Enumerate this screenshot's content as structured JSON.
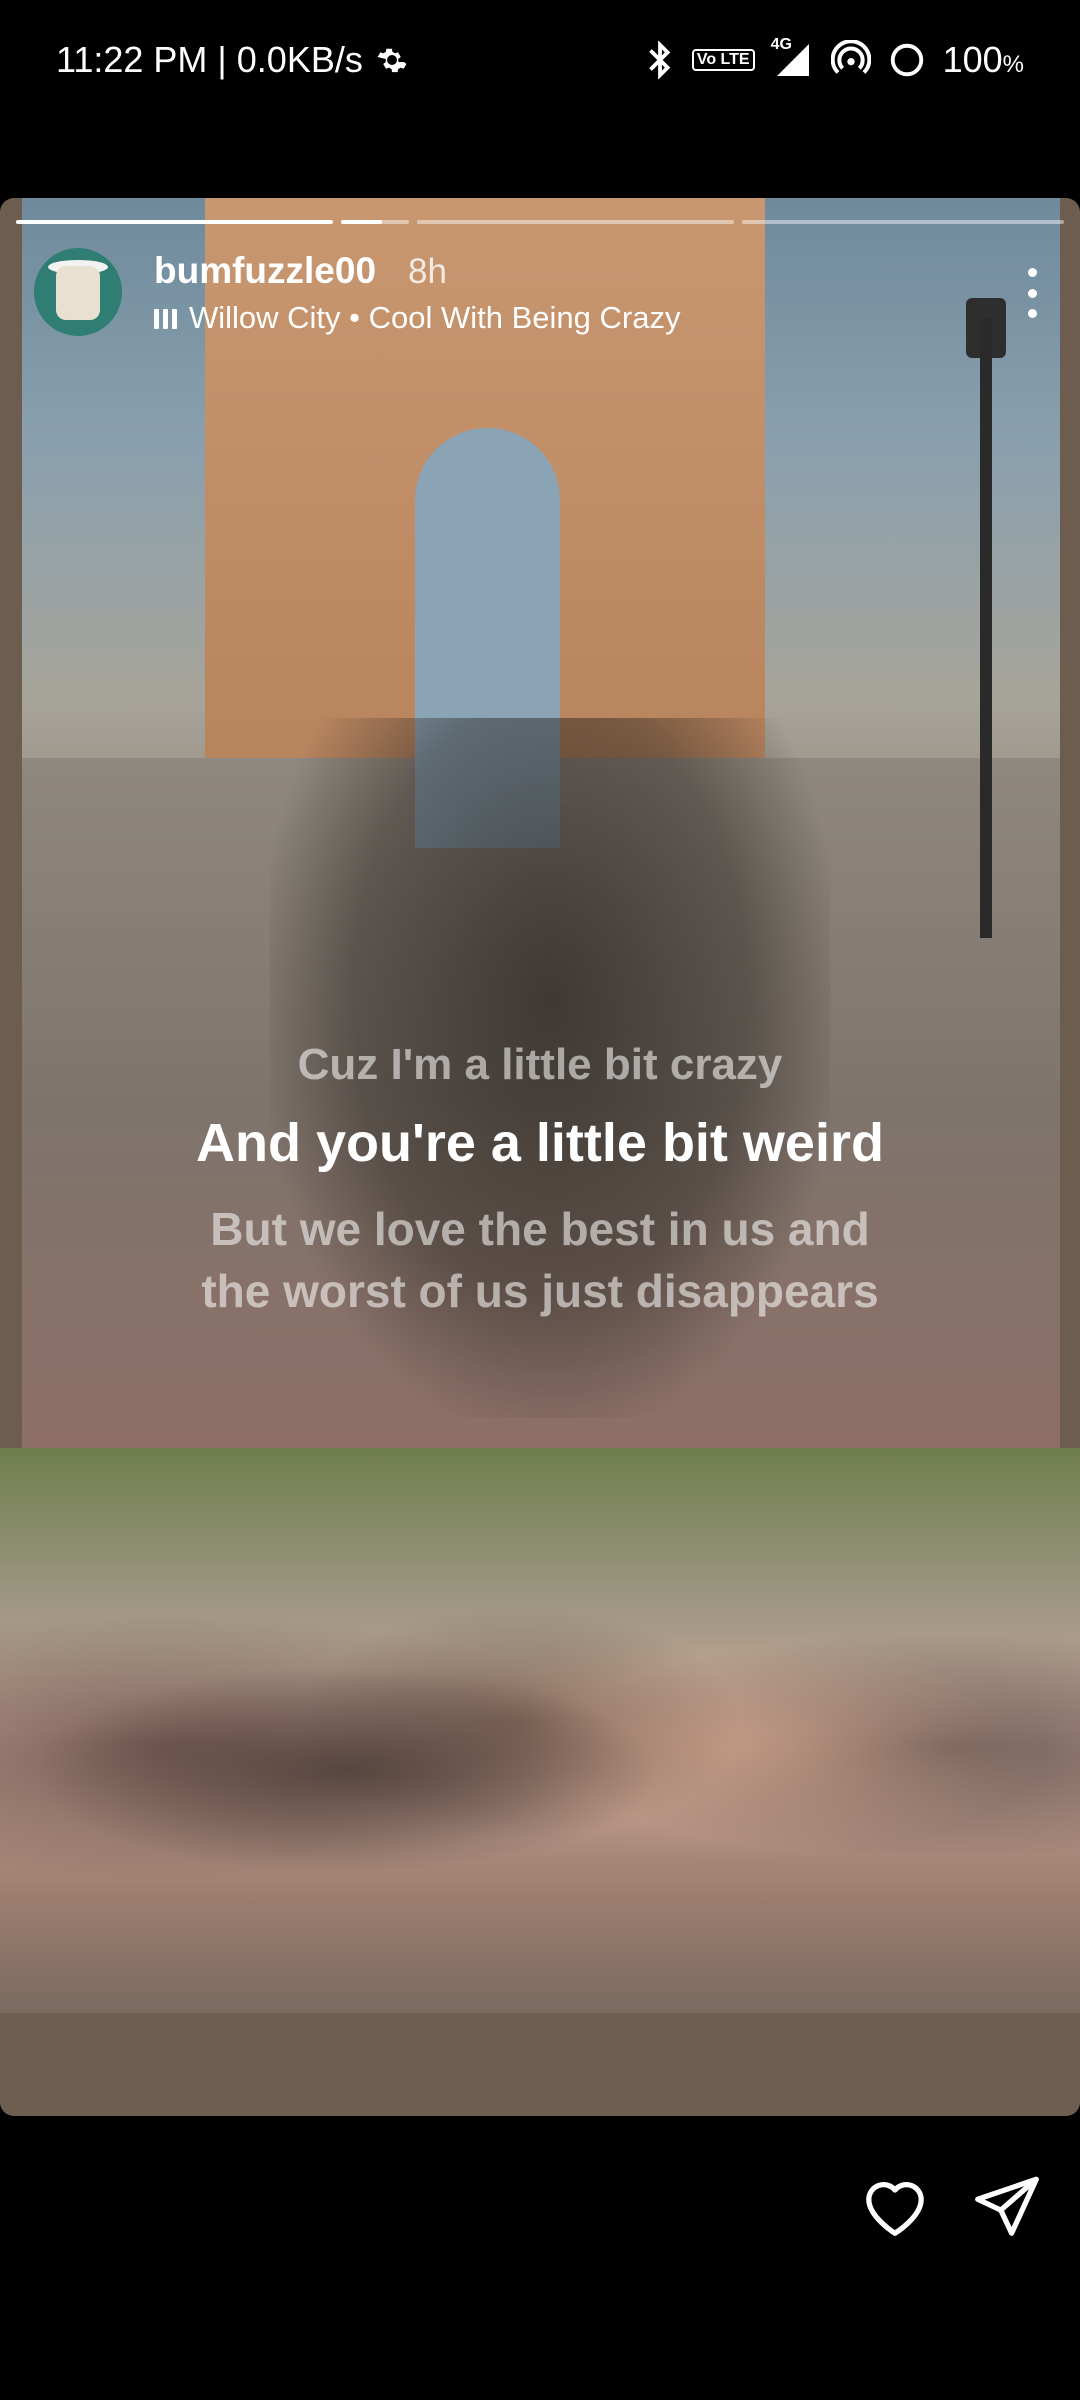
{
  "status_bar": {
    "time_speed": "11:22 PM | 0.0KB/s",
    "network": "4G",
    "volte": "Vo LTE",
    "battery": "100",
    "battery_unit": "%"
  },
  "story": {
    "username": "bumfuzzle00",
    "time_ago": "8h",
    "music": "Willow City • Cool With Being Crazy",
    "progress": {
      "segments": 4,
      "current_segment": 2,
      "current_segment_progress": 0.6
    },
    "lyrics": {
      "previous": "Cuz I'm a little bit crazy",
      "current": "And you're a little bit weird",
      "next_line1": "But we love the best in us and",
      "next_line2": "the worst of us just disappears"
    }
  },
  "icons": {
    "settings": "gear-icon",
    "bluetooth": "bluetooth-icon",
    "signal": "signal-icon",
    "hotspot": "hotspot-icon",
    "battery": "battery-icon",
    "more": "more-vertical-icon",
    "music": "music-bars-icon",
    "like": "heart-icon",
    "share": "send-icon"
  }
}
